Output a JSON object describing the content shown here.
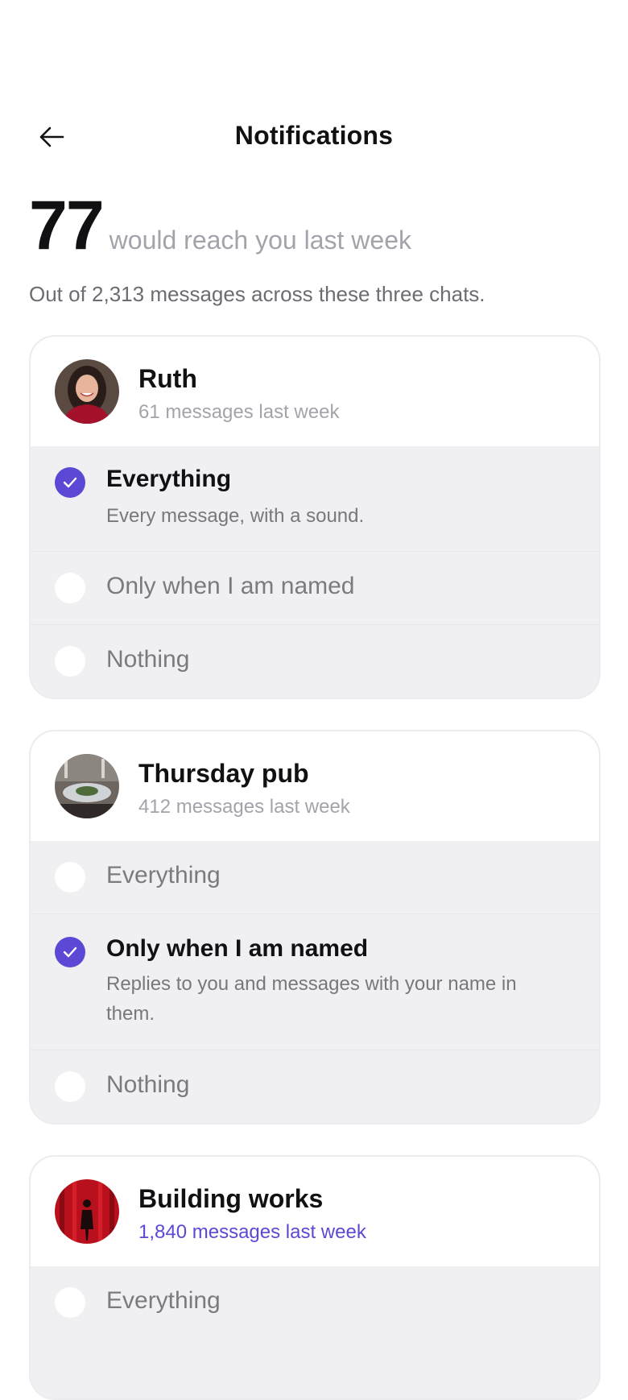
{
  "header": {
    "title": "Notifications",
    "back_icon": "arrow-left-icon"
  },
  "summary": {
    "count": "77",
    "reach_text": "would reach you last week",
    "subtext": "Out of 2,313 messages across these three chats."
  },
  "colors": {
    "accent": "#5b49d6",
    "muted": "#a3a3ab",
    "option_bg": "#f0f0f3"
  },
  "chats": [
    {
      "name": "Ruth",
      "count_text": "61 messages last week",
      "options": [
        {
          "label": "Everything",
          "selected": true,
          "description": "Every message, with a sound."
        },
        {
          "label": "Only when I am named",
          "selected": false
        },
        {
          "label": "Nothing",
          "selected": false
        }
      ]
    },
    {
      "name": "Thursday pub",
      "count_text": "412 messages last week",
      "options": [
        {
          "label": "Everything",
          "selected": false
        },
        {
          "label": "Only when I am named",
          "selected": true,
          "description": "Replies to you and messages with your name in them."
        },
        {
          "label": "Nothing",
          "selected": false
        }
      ]
    },
    {
      "name": "Building works",
      "count_text": "1,840 messages last week",
      "options": [
        {
          "label": "Everything",
          "selected": false
        }
      ]
    }
  ]
}
